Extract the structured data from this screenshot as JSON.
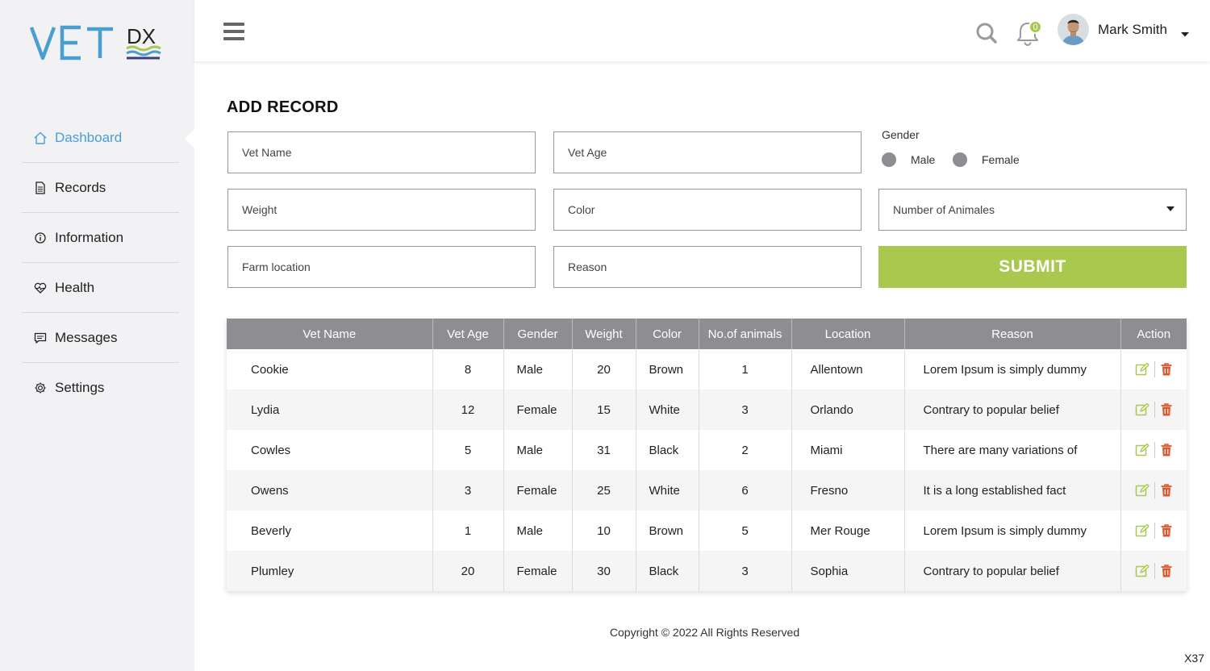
{
  "brand": {
    "primary": "VET",
    "secondary": "DX",
    "accent_color": "#a8c94e",
    "link_color": "#4a9fd1"
  },
  "sidebar": {
    "items": [
      {
        "label": "Dashboard",
        "icon": "home-icon",
        "active": true
      },
      {
        "label": "Records",
        "icon": "document-icon"
      },
      {
        "label": "Information",
        "icon": "info-icon"
      },
      {
        "label": "Health",
        "icon": "heartbeat-icon"
      },
      {
        "label": "Messages",
        "icon": "message-icon"
      },
      {
        "label": "Settings",
        "icon": "gear-icon"
      }
    ]
  },
  "topbar": {
    "notification_count": "0",
    "user_name": "Mark Smith"
  },
  "form": {
    "title": "ADD RECORD",
    "vet_name_placeholder": "Vet Name",
    "vet_age_placeholder": "Vet Age",
    "gender_label": "Gender",
    "gender_male": "Male",
    "gender_female": "Female",
    "weight_placeholder": "Weight",
    "color_placeholder": "Color",
    "animals_select": "Number of Animales",
    "farm_location_placeholder": "Farm location",
    "reason_placeholder": "Reason",
    "submit_label": "SUBMIT"
  },
  "table": {
    "headers": [
      "Vet Name",
      "Vet Age",
      "Gender",
      "Weight",
      "Color",
      "No.of animals",
      "Location",
      "Reason",
      "Action"
    ],
    "rows": [
      [
        "Cookie",
        "8",
        "Male",
        "20",
        "Brown",
        "1",
        "Allentown",
        "Lorem Ipsum is simply dummy"
      ],
      [
        "Lydia",
        "12",
        "Female",
        "15",
        "White",
        "3",
        "Orlando",
        "Contrary to popular belief"
      ],
      [
        "Cowles",
        "5",
        "Male",
        "31",
        "Black",
        "2",
        "Miami",
        "There are many variations of"
      ],
      [
        "Owens",
        "3",
        "Female",
        "25",
        "White",
        "6",
        "Fresno",
        "It is a long established fact"
      ],
      [
        "Beverly",
        "1",
        "Male",
        "10",
        "Brown",
        "5",
        "Mer Rouge",
        "Lorem Ipsum is simply dummy"
      ],
      [
        "Plumley",
        "20",
        "Female",
        "30",
        "Black",
        "3",
        "Sophia",
        "Contrary to popular belief"
      ]
    ]
  },
  "footer": {
    "copyright": "Copyright © 2022 All Rights Reserved",
    "corner_label": "X37"
  }
}
